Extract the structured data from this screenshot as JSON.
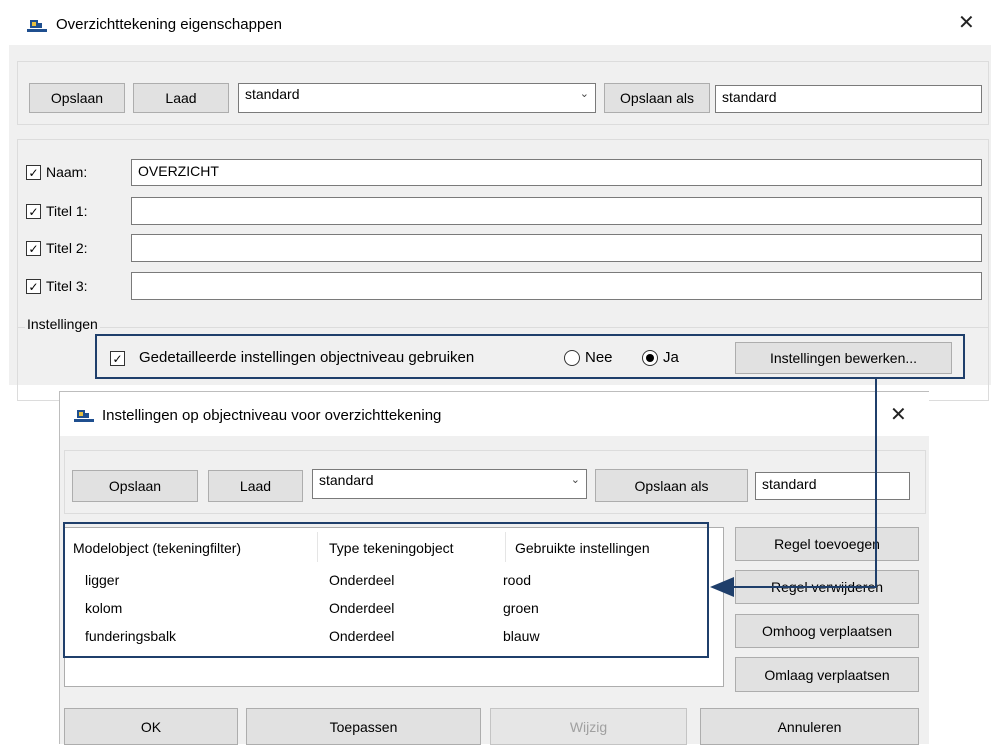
{
  "main_dialog": {
    "title": "Overzichttekening eigenschappen",
    "close_symbol": "✕",
    "toolbar": {
      "save_label": "Opslaan",
      "load_label": "Laad",
      "preset_value": "standard",
      "save_as_label": "Opslaan als",
      "save_as_value": "standard"
    },
    "fields": [
      {
        "label": "Naam:",
        "value": "OVERZICHT",
        "checked": true
      },
      {
        "label": "Titel 1:",
        "value": "",
        "checked": true
      },
      {
        "label": "Titel 2:",
        "value": "",
        "checked": true
      },
      {
        "label": "Titel 3:",
        "value": "",
        "checked": true
      }
    ],
    "settings": {
      "group_label": "Instellingen",
      "detailed_label": "Gedetailleerde instellingen objectniveau gebruiken",
      "radio_no": "Nee",
      "radio_yes": "Ja",
      "selected": "Ja",
      "edit_button": "Instellingen bewerken..."
    }
  },
  "object_dialog": {
    "title": "Instellingen op objectniveau voor overzichttekening",
    "close_symbol": "✕",
    "toolbar": {
      "save_label": "Opslaan",
      "load_label": "Laad",
      "preset_value": "standard",
      "save_as_label": "Opslaan als",
      "save_as_value": "standard"
    },
    "table": {
      "headers": [
        "Modelobject (tekeningfilter)",
        "Type tekeningobject",
        "Gebruikte instellingen"
      ],
      "rows": [
        [
          "ligger",
          "Onderdeel",
          "rood"
        ],
        [
          "kolom",
          "Onderdeel",
          "groen"
        ],
        [
          "funderingsbalk",
          "Onderdeel",
          "blauw"
        ]
      ]
    },
    "side_buttons": {
      "add_row": "Regel toevoegen",
      "remove_row": "Regel verwijderen",
      "move_up": "Omhoog verplaatsen",
      "move_down": "Omlaag verplaatsen"
    },
    "footer": {
      "ok": "OK",
      "apply": "Toepassen",
      "modify": "Wijzig",
      "cancel": "Annuleren"
    }
  },
  "colors": {
    "annotation": "#1f3f6b",
    "dialog_bg": "#f0f0f0",
    "button_bg": "#e1e1e1"
  },
  "icons": {
    "app": "tekla-app-icon",
    "checkbox": "check-icon",
    "dropdown": "chevron-down-icon",
    "annotation_arrow": "arrow-left-icon"
  }
}
